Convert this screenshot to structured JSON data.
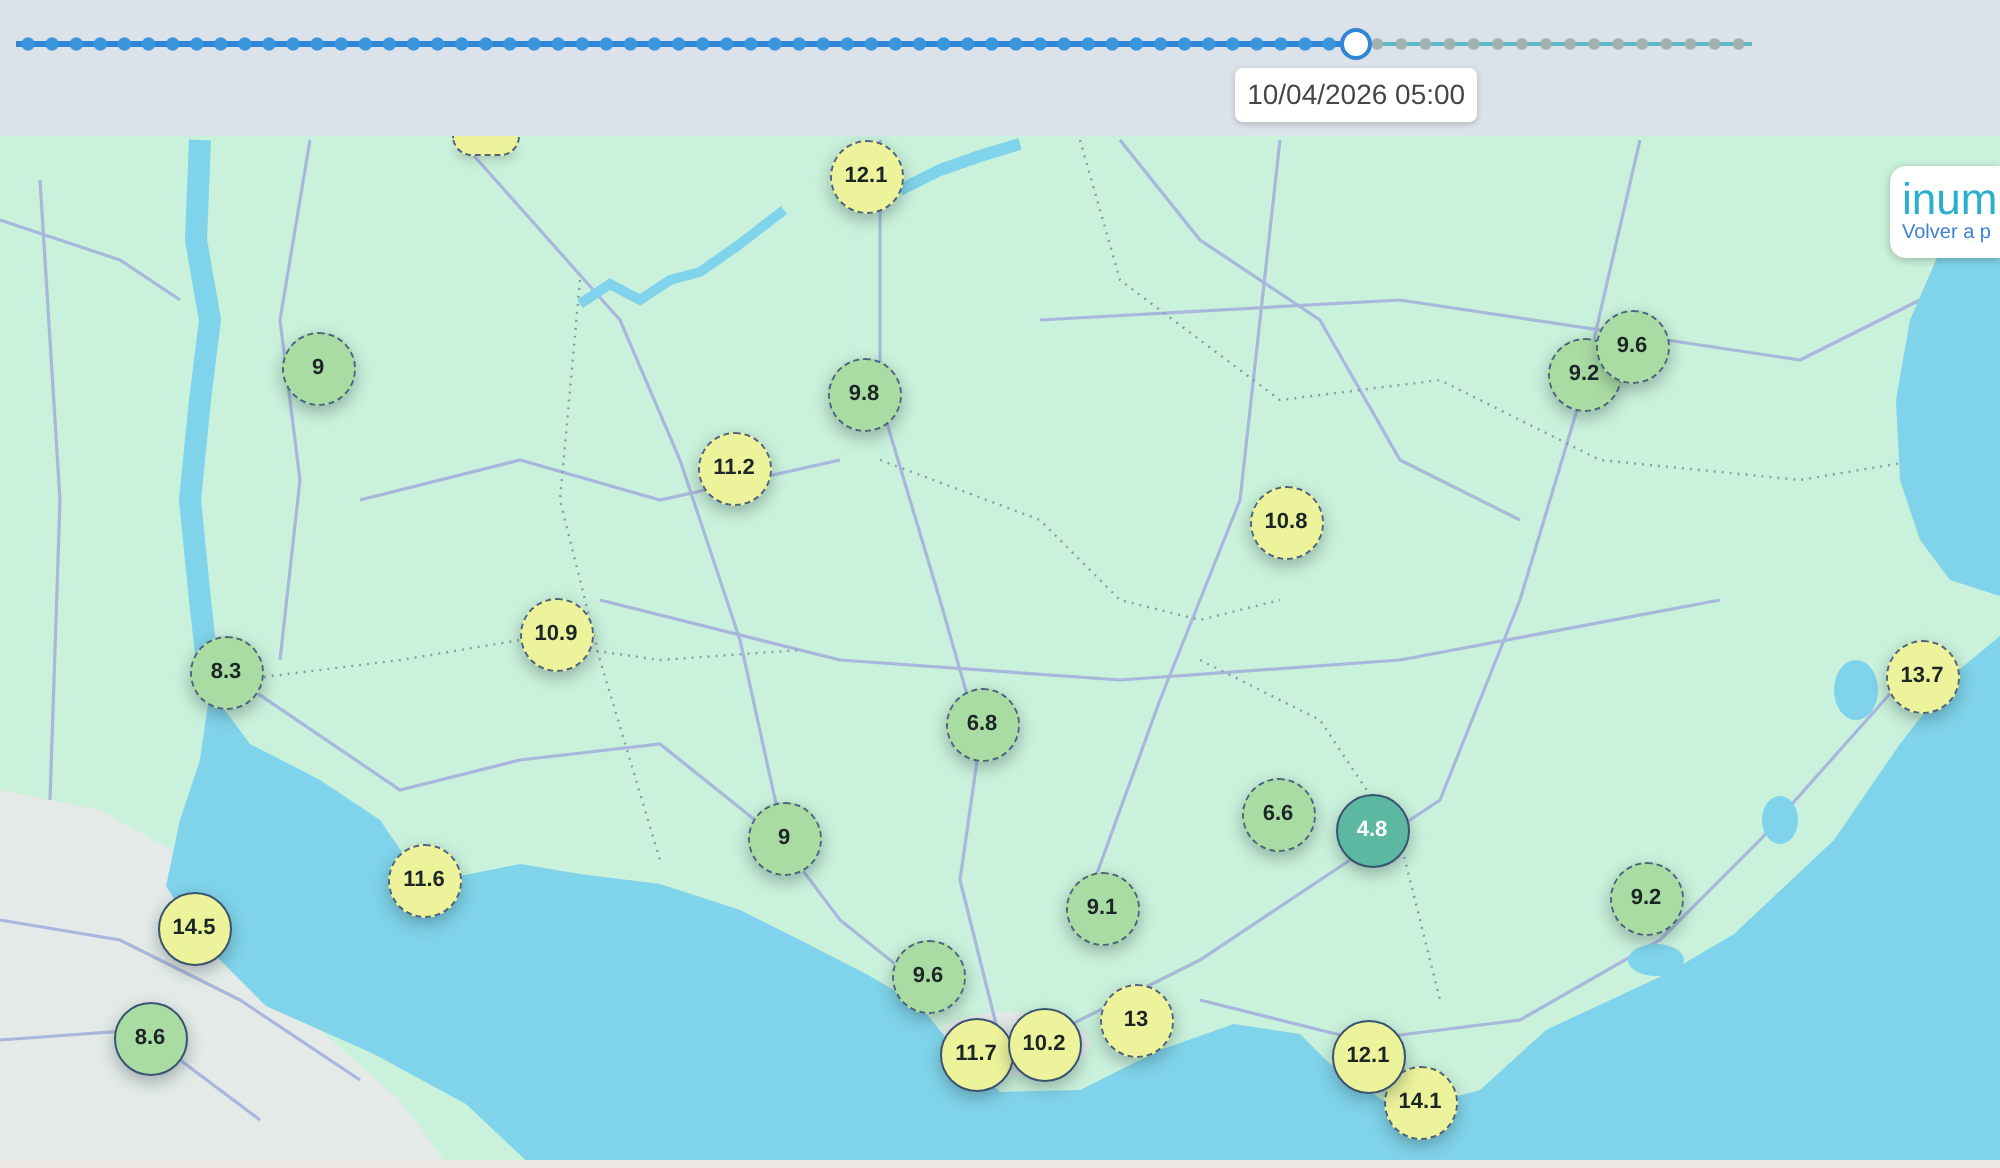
{
  "timeline": {
    "level": 0.772,
    "tooltip": "10/04/2026 05:00"
  },
  "map": {
    "markers": [
      {
        "kind": "clipped",
        "color": "#ecf39b"
      },
      {
        "kind": "dashed",
        "color": "#ecf39b",
        "value": "12.1"
      },
      {
        "kind": "dashed",
        "color": "#a9dca3",
        "value": "9"
      },
      {
        "kind": "dashed",
        "color": "#a9dca3",
        "value": "9.8"
      },
      {
        "kind": "dashed",
        "color": "#ecf39b",
        "value": "11.2"
      },
      {
        "kind": "dashed",
        "color": "#ecf39b",
        "value": "10.8"
      },
      {
        "kind": "dashed",
        "color": "#a9dca3",
        "value": "9.2"
      },
      {
        "kind": "dashed",
        "color": "#a9dca3",
        "value": "9.6"
      },
      {
        "kind": "dashed",
        "color": "#ecf39b",
        "value": "10.9"
      },
      {
        "kind": "dashed",
        "color": "#a9dca3",
        "value": "8.3"
      },
      {
        "kind": "dashed",
        "color": "#ecf39b",
        "value": "13.7"
      },
      {
        "kind": "dashed",
        "color": "#a9dca3",
        "value": "6.8"
      },
      {
        "kind": "dashed",
        "color": "#a9dca3",
        "value": "6.6"
      },
      {
        "kind": "solid",
        "color": "#5cb8a0",
        "value": "4.8"
      },
      {
        "kind": "dashed",
        "color": "#a9dca3",
        "value": "9"
      },
      {
        "kind": "dashed",
        "color": "#ecf39b",
        "value": "11.6"
      },
      {
        "kind": "dashed",
        "color": "#a9dca3",
        "value": "9.1"
      },
      {
        "kind": "dashed",
        "color": "#a9dca3",
        "value": "9.2"
      },
      {
        "kind": "solid",
        "color": "#ecf39b",
        "value": "14.5"
      },
      {
        "kind": "dashed",
        "color": "#a9dca3",
        "value": "9.6"
      },
      {
        "kind": "dashed",
        "color": "#ecf39b",
        "value": "13"
      },
      {
        "kind": "solid",
        "color": "#a9dca3",
        "value": "8.6"
      },
      {
        "kind": "solid",
        "color": "#ecf39b",
        "value": "11.7"
      },
      {
        "kind": "solid",
        "color": "#ecf39b",
        "value": "10.2"
      },
      {
        "kind": "dashed",
        "color": "#ecf39b",
        "value": "14.1"
      },
      {
        "kind": "solid",
        "color": "#ecf39b",
        "value": "12.1"
      }
    ]
  },
  "logo_card": {
    "logo": "inum",
    "link": "Volver a p"
  }
}
